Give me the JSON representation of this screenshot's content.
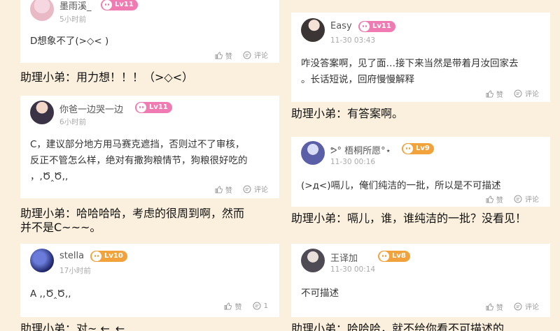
{
  "left_column": [
    {
      "user": {
        "name": "墨雨溪_",
        "time": "5小时前",
        "level": "Lv11",
        "level_color": "#f07bb2"
      },
      "content": [
        "D想象不了(>◇< )"
      ],
      "actions": {
        "like": "赞",
        "comment": "评论"
      },
      "reply": [
        "助理小弟：用力想！！！（>◇<）"
      ]
    },
    {
      "user": {
        "name": "你爸一边哭一边",
        "time": "6小时前",
        "level": "Lv11",
        "level_color": "#f07bb2"
      },
      "content": [
        "C，建议部分地方用马赛克遮挡，否则过不了审核，",
        "反正不管怎么样，绝对有撒狗粮情节，狗粮很好吃的",
        "，,Ծ‸Ծ,,"
      ],
      "actions": {
        "like": "赞",
        "comment": "评论"
      },
      "reply": [
        "助理小弟：哈哈哈哈，考虑的很周到啊，然而",
        "并不是C~~~。"
      ]
    },
    {
      "user": {
        "name": "stella",
        "time": "17小时前",
        "level": "Lv10",
        "level_color": "#f2a23a"
      },
      "content": [
        "A ,,Ծ‸Ծ,,"
      ],
      "actions": {
        "like": "赞",
        "comment": "1"
      },
      "reply": [
        "助理小弟：对~ ←_←"
      ]
    }
  ],
  "right_column": [
    {
      "user": {
        "name": "Easy",
        "time": "11-30 03:43",
        "level": "Lv11",
        "level_color": "#f07bb2"
      },
      "content": [
        "咋没答案啊，见了面…接下来当然是带着月汝回家去",
        "。长话短说，回府慢慢解释"
      ],
      "actions": {
        "like": "赞",
        "comment": "评论"
      },
      "reply": [
        "助理小弟：有答案啊。"
      ]
    },
    {
      "user": {
        "name": "ᕗ° 梧桐所愿°⋆",
        "time": "11-30 00:16",
        "level": "Lv9",
        "level_color": "#f2a23a"
      },
      "content": [
        "(>д<)嗝儿，俺们纯洁的一批，所以是不可描述"
      ],
      "actions": {
        "like": "赞",
        "comment": "评论"
      },
      "reply": [
        "助理小弟：嗝儿，谁，谁纯洁的一批？没看见！"
      ]
    },
    {
      "user": {
        "name": "王译加",
        "time": "11-30 00:14",
        "level": "Lv8",
        "level_color": "#f2a23a"
      },
      "content": [
        "不可描述"
      ],
      "actions": {
        "like": "赞",
        "comment": "评论"
      },
      "reply": [
        "助理小弟：哈哈哈，就不给你看不可描述的"
      ]
    }
  ]
}
